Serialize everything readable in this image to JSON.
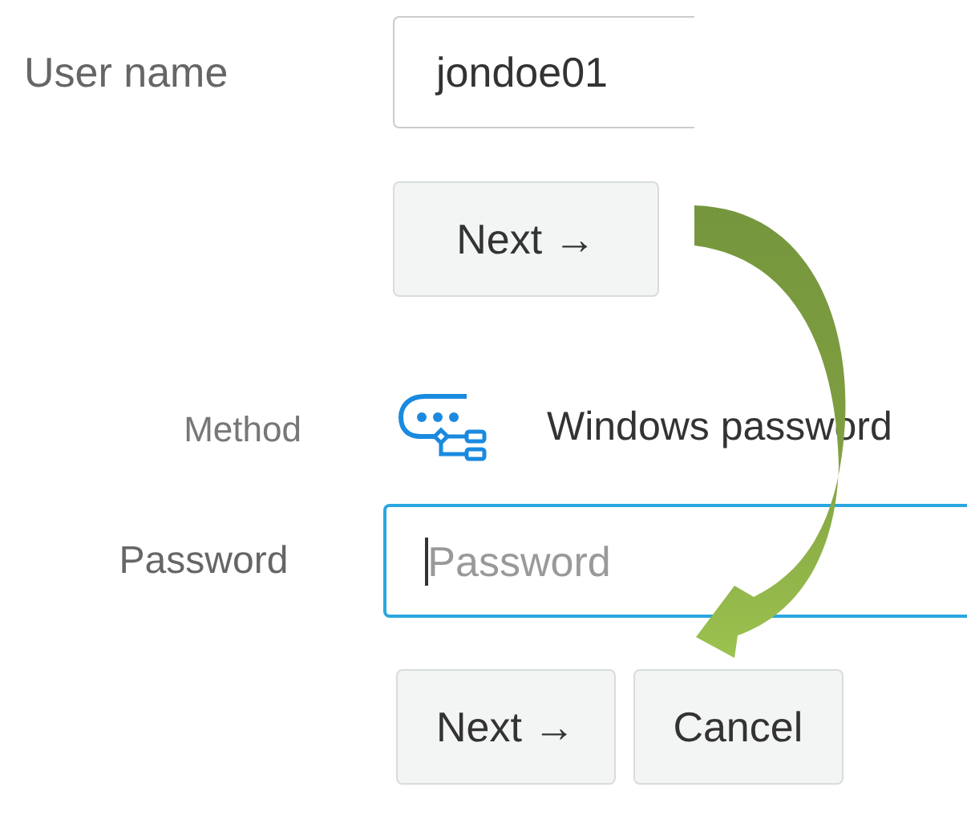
{
  "username": {
    "label": "User name",
    "value": "jondoe01"
  },
  "next_button": {
    "label": "Next →"
  },
  "method": {
    "label": "Method",
    "value": "Windows password"
  },
  "password": {
    "label": "Password",
    "placeholder": "Password",
    "focused": true
  },
  "buttons": [
    {
      "label": "Next →"
    },
    {
      "label": "Cancel"
    }
  ]
}
